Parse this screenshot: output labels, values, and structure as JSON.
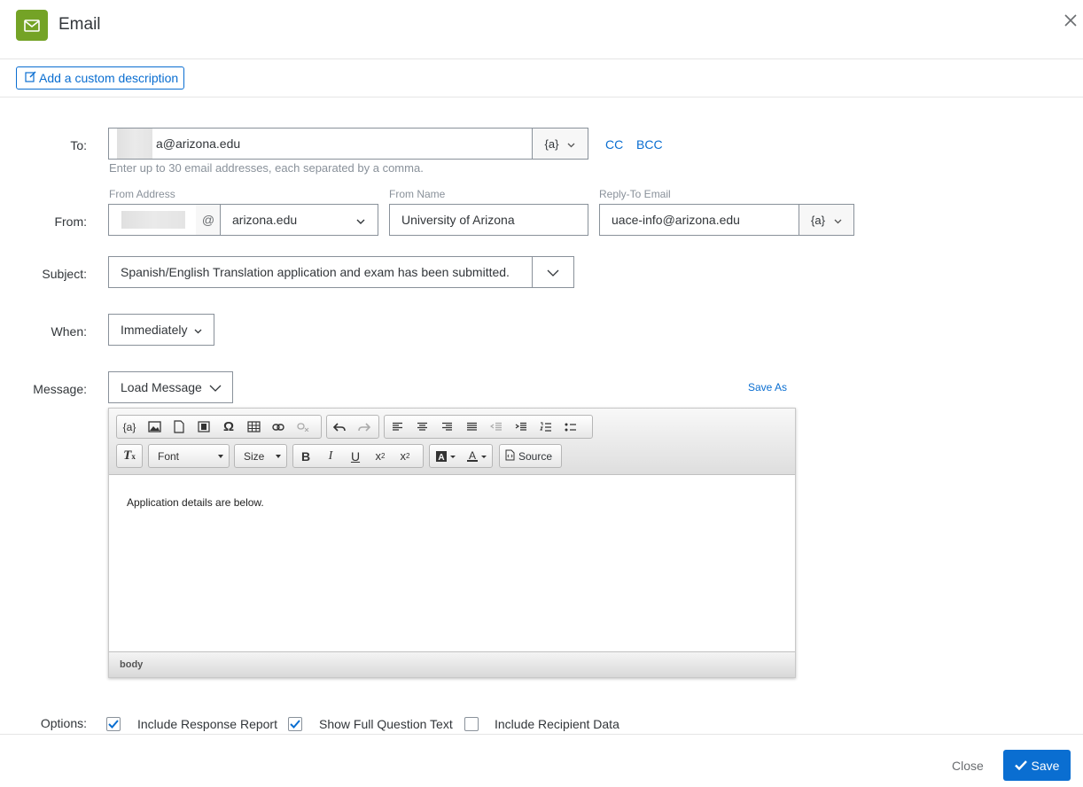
{
  "header": {
    "title": "Email"
  },
  "description_button": "Add a custom description",
  "to": {
    "label": "To:",
    "value": "a@arizona.edu",
    "hint": "Enter up to 30 email addresses, each separated by a comma.",
    "piped_label": "{a}",
    "cc": "CC",
    "bcc": "BCC"
  },
  "from": {
    "label": "From:",
    "from_address_label": "From Address",
    "at": "@",
    "domain": "arizona.edu",
    "from_name_label": "From Name",
    "from_name": "University of Arizona",
    "reply_to_label": "Reply-To Email",
    "reply_to": "uace-info@arizona.edu",
    "piped_label": "{a}"
  },
  "subject": {
    "label": "Subject:",
    "value": "Spanish/English Translation application and exam has been submitted."
  },
  "when": {
    "label": "When:",
    "value": "Immediately"
  },
  "message": {
    "label": "Message:",
    "load_message": "Load Message",
    "save_as": "Save As",
    "toolbar": {
      "piped": "{a}",
      "font": "Font",
      "size": "Size",
      "source": "Source"
    },
    "body": "Application details are below.",
    "status": "body"
  },
  "options": {
    "label": "Options:",
    "items": [
      {
        "label": "Include Response Report",
        "checked": true
      },
      {
        "label": "Show Full Question Text",
        "checked": true
      },
      {
        "label": "Include Recipient Data",
        "checked": false
      }
    ]
  },
  "footer": {
    "close": "Close",
    "save": "Save"
  },
  "colors": {
    "accent": "#0a6ed1",
    "email_icon_bg": "#74a326"
  }
}
